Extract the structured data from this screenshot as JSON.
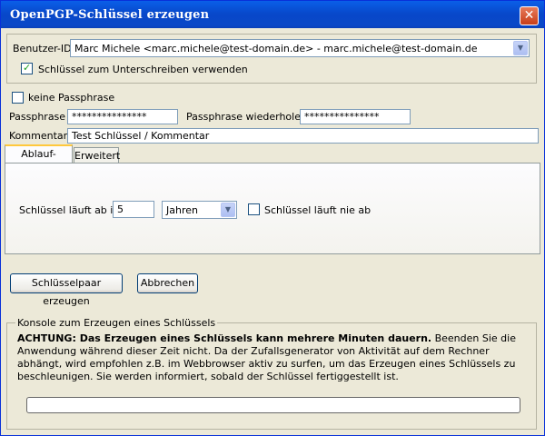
{
  "window": {
    "title": "OpenPGP-Schlüssel erzeugen",
    "close_symbol": "✕"
  },
  "user_id": {
    "label": "Benutzer-ID",
    "value": "Marc Michele <marc.michele@test-domain.de> - marc.michele@test-domain.de",
    "use_for_signing_label": "Schlüssel zum Unterschreiben verwenden",
    "use_for_signing_checked": true
  },
  "passphrase": {
    "no_passphrase_label": "keine Passphrase",
    "no_passphrase_checked": false,
    "passphrase_label": "Passphrase",
    "passphrase_value": "***************",
    "repeat_label": "Passphrase wiederholen",
    "repeat_value": "***************"
  },
  "comment": {
    "label": "Kommentar",
    "value": "Test Schlüssel / Kommentar"
  },
  "tabs": [
    {
      "label": "Ablauf-Datum",
      "active": true
    },
    {
      "label": "Erweitert",
      "active": false
    }
  ],
  "expiry": {
    "label": "Schlüssel läuft ab in",
    "amount": "5",
    "unit": "Jahren",
    "never_label": "Schlüssel läuft nie ab",
    "never_checked": false
  },
  "buttons": {
    "generate": "Schlüsselpaar erzeugen",
    "cancel": "Abbrechen"
  },
  "console": {
    "title": "Konsole zum Erzeugen eines Schlüssels",
    "warning_bold": "ACHTUNG: Das Erzeugen eines Schlüssels kann mehrere Minuten dauern.",
    "warning_text": " Beenden Sie die Anwendung während dieser Zeit nicht. Da der Zufallsgenerator von Aktivität auf dem Rechner abhängt, wird empfohlen z.B. im Webbrowser aktiv zu surfen, um das Erzeugen eines Schlüssels zu beschleunigen. Sie werden informiert, sobald der Schlüssel fertiggestellt ist.",
    "progress_percent": 0
  },
  "colors": {
    "titlebar": "#0a5fe8",
    "window_bg": "#ece9d8",
    "tab_highlight": "#ffc83c"
  }
}
